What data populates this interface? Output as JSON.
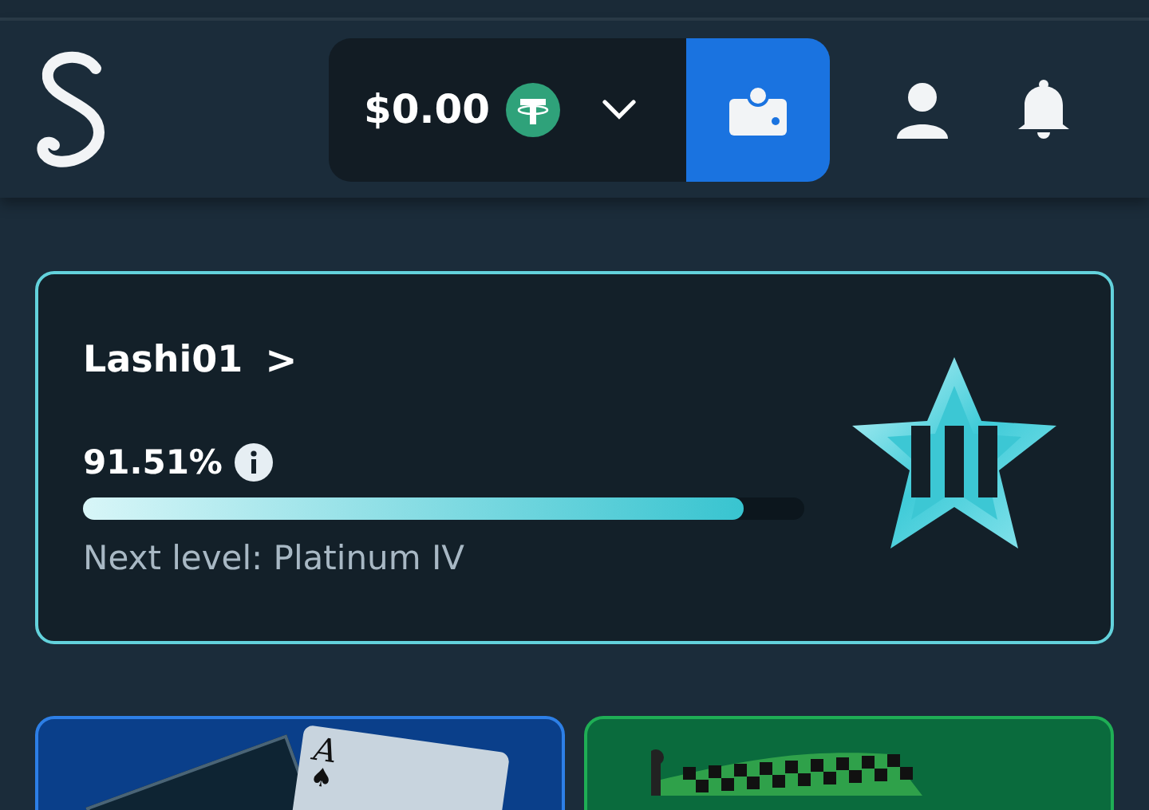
{
  "header": {
    "balance": "$0.00"
  },
  "vip_card": {
    "username": "Lashi01",
    "chevron": ">",
    "progress_text": "91.51%",
    "level": 0.9151,
    "next_level": "Next level: Platinum IV"
  },
  "game_tiles": [
    {
      "kind": "cards",
      "card_rank": "A",
      "card_suit": "♠"
    },
    {
      "kind": "flag"
    }
  ]
}
